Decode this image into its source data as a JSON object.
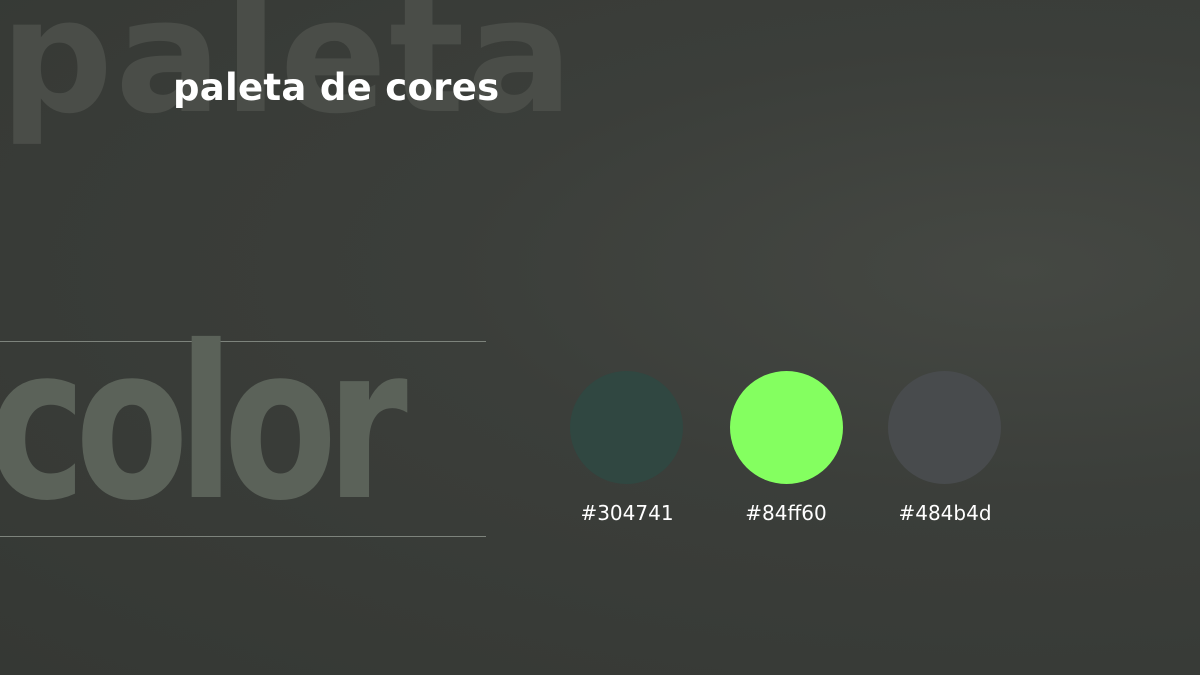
{
  "background": {
    "word_top": "paleta",
    "word_color": "color"
  },
  "title": "paleta de cores",
  "swatches": [
    {
      "hex": "#304741",
      "color": "#304741"
    },
    {
      "hex": "#84ff60",
      "color": "#84ff60"
    },
    {
      "hex": "#484b4d",
      "color": "#484b4d"
    }
  ]
}
